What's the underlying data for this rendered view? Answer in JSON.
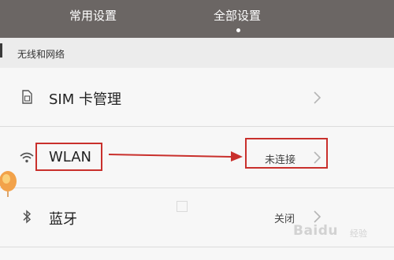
{
  "tabs": {
    "common": "常用设置",
    "all": "全部设置",
    "selected": "all"
  },
  "section": {
    "title": "无线和网络"
  },
  "rows": {
    "sim": {
      "label": "SIM 卡管理",
      "icon": "sim-card-icon"
    },
    "wlan": {
      "label": "WLAN",
      "value": "未连接",
      "icon": "wifi-icon"
    },
    "bluetooth": {
      "label": "蓝牙",
      "value": "关闭",
      "icon": "bluetooth-icon"
    }
  },
  "annotation": {
    "color": "#c9302c"
  },
  "watermark": {
    "text": "Baidu",
    "suffix": "经验"
  },
  "colors": {
    "topbar": "#6b6664",
    "row_bg": "#f7f7f7",
    "section_bg": "#ececec"
  }
}
